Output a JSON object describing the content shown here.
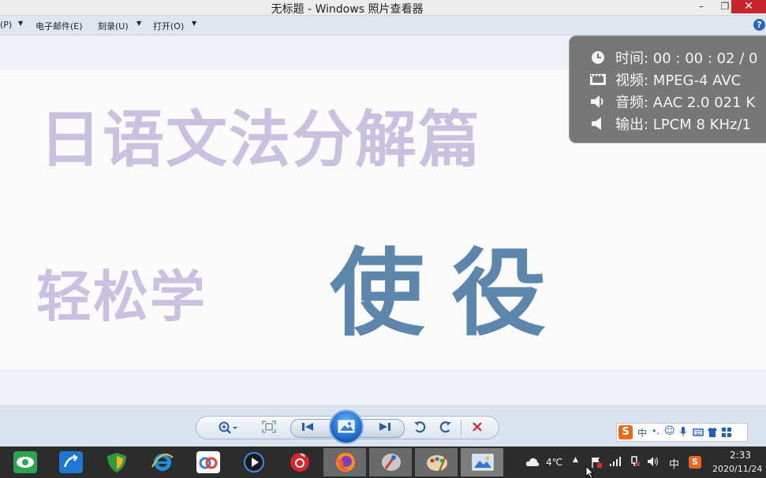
{
  "window": {
    "title": "无标题 - Windows 照片查看器",
    "minimize_glyph": "–",
    "maximize_glyph": "❐",
    "close_glyph": "✕"
  },
  "menu": {
    "items": [
      {
        "label": "(P)"
      },
      {
        "label": "电子邮件(E)"
      },
      {
        "label": "刻录(U)"
      },
      {
        "label": "打开(O)"
      }
    ],
    "help_icon": "?"
  },
  "image": {
    "title": "日语文法分解篇",
    "subtitle": "轻松学",
    "word": "使役"
  },
  "overlay": {
    "rows": [
      {
        "icon": "clock-icon",
        "text": "时间: 00 : 00 : 02 / 0"
      },
      {
        "icon": "video-icon",
        "text": "视频: MPEG-4 AVC"
      },
      {
        "icon": "speaker-icon",
        "text": "音频: AAC 2.0  021 K"
      },
      {
        "icon": "output-speaker-icon",
        "text": "输出: LPCM 8 KHz/1"
      }
    ]
  },
  "ime": {
    "items": [
      "中",
      "•,",
      "☺",
      "🎤",
      "⌨",
      "👕",
      "▦"
    ]
  },
  "taskbar": {
    "weather": "4℃",
    "ime_indicator": "中",
    "time": "2:33",
    "date": "2020/11/24"
  },
  "colors": {
    "title_text": "#cac0e0",
    "word_text": "#5d86ad",
    "close_button": "#c7242b",
    "overlay_bg": "#737373"
  }
}
